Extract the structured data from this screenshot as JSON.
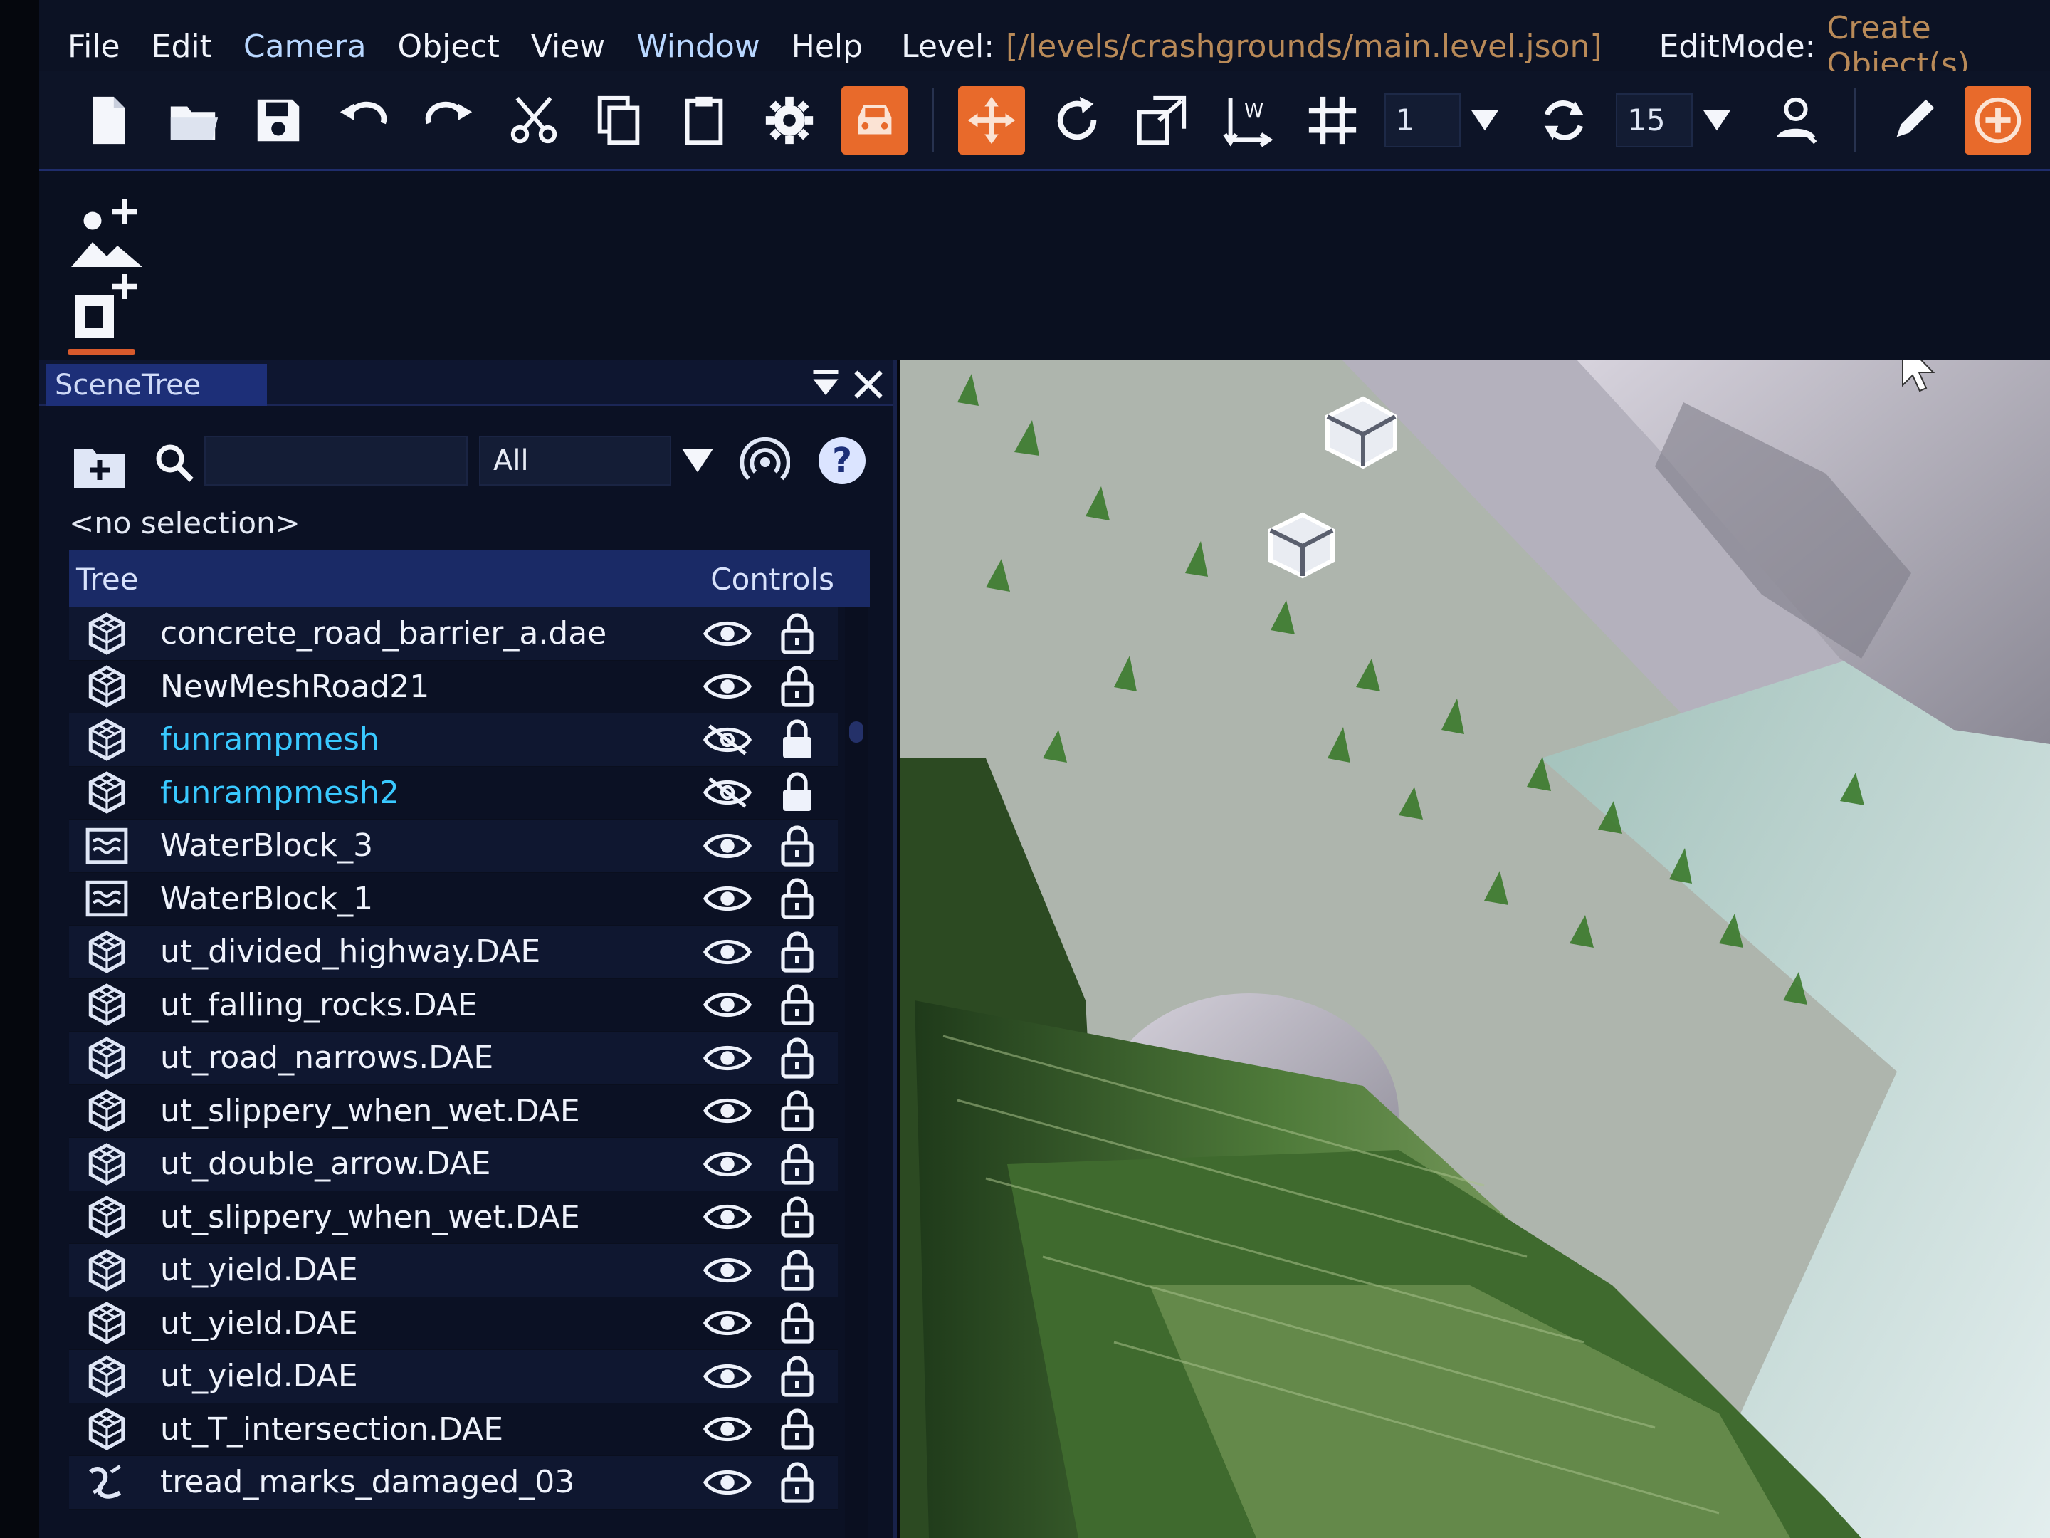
{
  "menu": {
    "items": [
      "File",
      "Edit",
      "Camera",
      "Object",
      "View",
      "Window",
      "Help"
    ],
    "level_label": "Level:",
    "level_value": "[/levels/crashgrounds/main.level.json]",
    "editmode_label": "EditMode:",
    "editmode_value": "Create Object(s)"
  },
  "toolbar": {
    "snap_value": "1",
    "rotate_snap_value": "15"
  },
  "scenetree": {
    "tab_title": "SceneTree",
    "search_value": "",
    "filter_value": "All",
    "help_label": "?",
    "selection_text": "<no selection>",
    "col_tree": "Tree",
    "col_controls": "Controls",
    "rows": [
      {
        "label": "concrete_road_barrier_a.dae",
        "icon": "mesh-icon",
        "visible": true
      },
      {
        "label": "NewMeshRoad21",
        "icon": "mesh-icon",
        "visible": true
      },
      {
        "label": "funrampmesh",
        "icon": "mesh-icon",
        "visible": false
      },
      {
        "label": "funrampmesh2",
        "icon": "mesh-icon",
        "visible": false
      },
      {
        "label": "WaterBlock_3",
        "icon": "water-icon",
        "visible": true
      },
      {
        "label": "WaterBlock_1",
        "icon": "water-icon",
        "visible": true
      },
      {
        "label": "ut_divided_highway.DAE",
        "icon": "mesh-icon",
        "visible": true
      },
      {
        "label": "ut_falling_rocks.DAE",
        "icon": "mesh-icon",
        "visible": true
      },
      {
        "label": "ut_road_narrows.DAE",
        "icon": "mesh-icon",
        "visible": true
      },
      {
        "label": "ut_slippery_when_wet.DAE",
        "icon": "mesh-icon",
        "visible": true
      },
      {
        "label": "ut_double_arrow.DAE",
        "icon": "mesh-icon",
        "visible": true
      },
      {
        "label": "ut_slippery_when_wet.DAE",
        "icon": "mesh-icon",
        "visible": true
      },
      {
        "label": "ut_yield.DAE",
        "icon": "mesh-icon",
        "visible": true
      },
      {
        "label": "ut_yield.DAE",
        "icon": "mesh-icon",
        "visible": true
      },
      {
        "label": "ut_yield.DAE",
        "icon": "mesh-icon",
        "visible": true
      },
      {
        "label": "ut_T_intersection.DAE",
        "icon": "mesh-icon",
        "visible": true
      },
      {
        "label": "tread_marks_damaged_03",
        "icon": "decal-road-icon",
        "visible": true
      }
    ]
  },
  "colors": {
    "accent_orange": "#e86a2b",
    "hidden_object_text": "#39c9ff",
    "panel_header": "#1a2a66",
    "level_path": "#b98a58"
  }
}
